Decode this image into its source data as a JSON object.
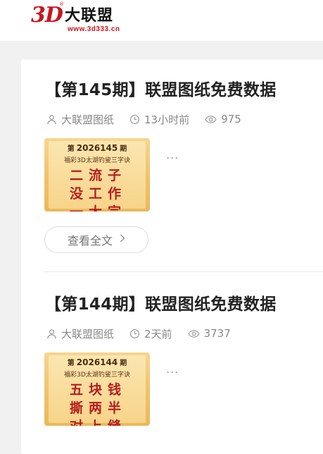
{
  "header": {
    "logo_mark": "3D",
    "logo_reg": "®",
    "logo_brand": "大联盟",
    "logo_url": "www.3d333.cn"
  },
  "posts": [
    {
      "title": "【第145期】联盟图纸免费数据",
      "author": "大联盟图纸",
      "time": "13小时前",
      "views": "975",
      "thumb": {
        "issue_prefix": "第",
        "issue_number": "2026145",
        "issue_suffix": "期",
        "subtitle": "福彩3D太湖钓叟三字诀",
        "verse_lines": [
          "二流子",
          "没工作",
          "一大宗"
        ]
      },
      "more": "...",
      "read_more": "查看全文"
    },
    {
      "title": "【第144期】联盟图纸免费数据",
      "author": "大联盟图纸",
      "time": "2天前",
      "views": "3737",
      "thumb": {
        "issue_prefix": "第",
        "issue_number": "2026144",
        "issue_suffix": "期",
        "subtitle": "福彩3D太湖钓叟三字诀",
        "verse_lines": [
          "五块钱",
          "撕两半",
          "对上缝"
        ]
      },
      "more": "..."
    }
  ],
  "icons": {
    "author": "user-icon",
    "time": "clock-icon",
    "views": "eye-icon",
    "read_more": "chevron-right-icon"
  },
  "colors": {
    "brand_red": "#c8161d",
    "title": "#222222",
    "meta": "#888888",
    "page_bg": "#f1f1f1"
  }
}
